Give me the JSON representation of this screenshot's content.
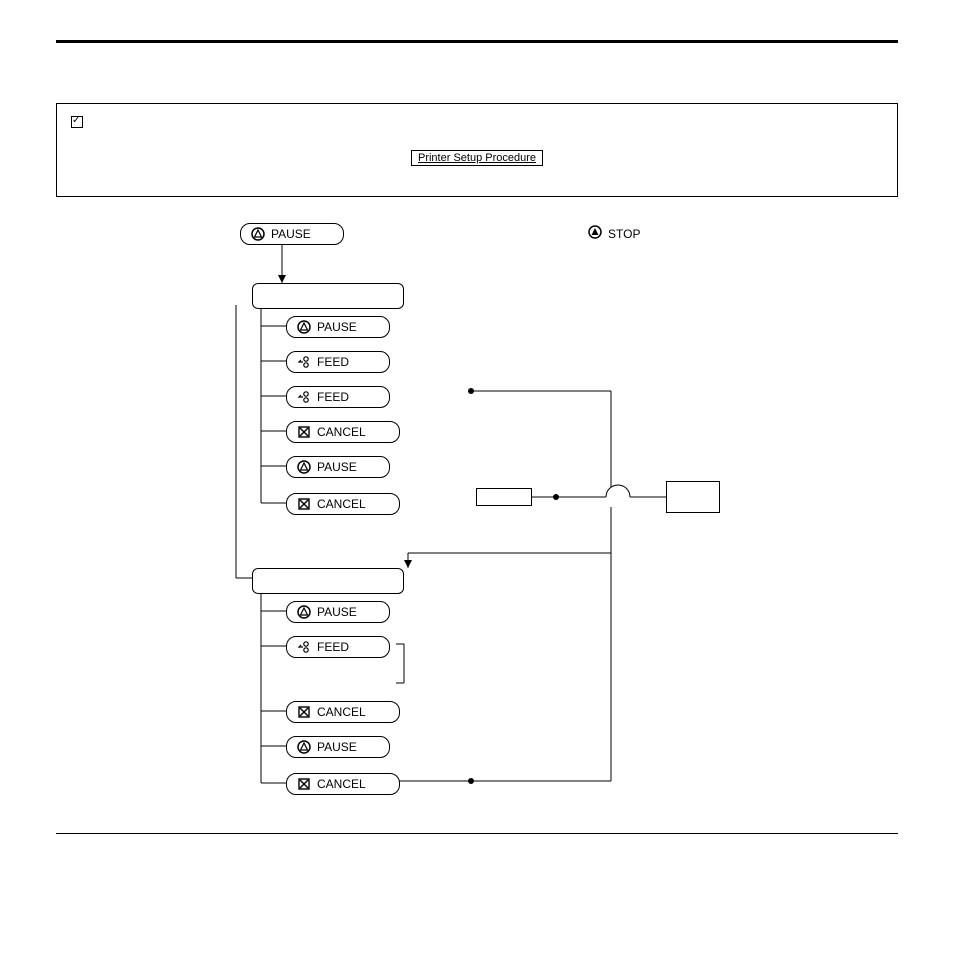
{
  "note": {
    "proc_link": "Printer Setup Procedure"
  },
  "buttons": {
    "pause": "PAUSE",
    "feed": "FEED",
    "cancel": "CANCEL",
    "stop": "STOP"
  }
}
